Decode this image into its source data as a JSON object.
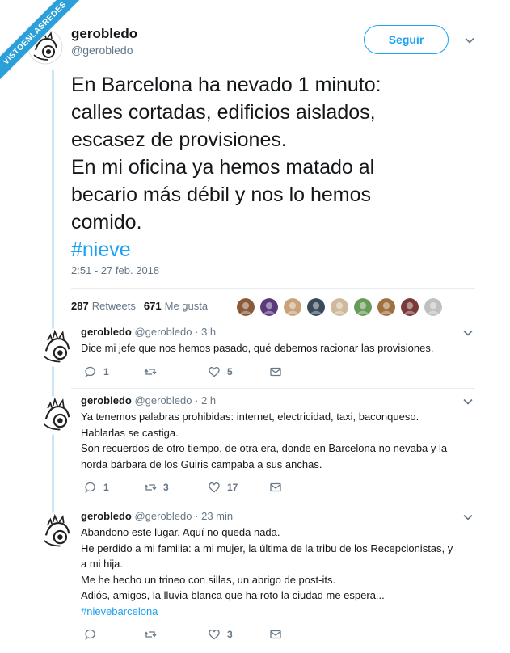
{
  "watermark": {
    "text": "VISTOENLASREDES"
  },
  "main_tweet": {
    "display_name": "gerobledo",
    "handle": "@gerobledo",
    "follow_label": "Seguir",
    "text_lines": [
      "En Barcelona ha nevado 1 minuto:",
      "calles cortadas, edificios aislados,",
      "escasez de provisiones.",
      "En mi oficina ya hemos matado al",
      "becario más débil y nos lo hemos",
      "comido."
    ],
    "hashtag": "#nieve",
    "timestamp": "2:51 - 27 feb. 2018",
    "retweets_count": "287",
    "retweets_label": "Retweets",
    "likes_count": "671",
    "likes_label": "Me gusta",
    "liker_avatar_colors": [
      "#8a5a3a",
      "#5a3a7a",
      "#c9a27a",
      "#3a4a5a",
      "#d0b89a",
      "#6a9a5a",
      "#a07040",
      "#7a3a3a",
      "#c0c0c0"
    ]
  },
  "replies": [
    {
      "display_name": "gerobledo",
      "handle": "@gerobledo",
      "time": "3 h",
      "text_lines": [
        "Dice mi jefe que nos hemos pasado, qué debemos racionar las provisiones."
      ],
      "reply_count": "1",
      "retweet_count": "",
      "like_count": "5"
    },
    {
      "display_name": "gerobledo",
      "handle": "@gerobledo",
      "time": "2 h",
      "text_lines": [
        "Ya tenemos palabras prohibidas: internet, electricidad, taxi, baconqueso.",
        "Hablarlas se castiga.",
        "Son recuerdos de otro tiempo, de otra era, donde en Barcelona no nevaba y la",
        "horda bárbara de los Guiris campaba a sus anchas."
      ],
      "reply_count": "1",
      "retweet_count": "3",
      "like_count": "17"
    },
    {
      "display_name": "gerobledo",
      "handle": "@gerobledo",
      "time": "23 min",
      "text_lines": [
        "Abandono este lugar. Aquí no queda nada.",
        "He perdido a mi familia: a mi mujer, la última de la tribu de los Recepcionistas, y",
        "a mi hija.",
        "Me he hecho un trineo con sillas, un abrigo de post-its.",
        "Adiós, amigos, la lluvia-blanca que ha roto la ciudad me espera..."
      ],
      "hashtag": "#nievebarcelona",
      "reply_count": "",
      "retweet_count": "",
      "like_count": "3"
    }
  ],
  "colors": {
    "accent": "#1da1f2",
    "muted": "#657786",
    "text": "#14171a",
    "thread_line": "#cce6f8",
    "ribbon": "#2b9fd8"
  },
  "icons": [
    "chevron-down-icon",
    "reply-icon",
    "retweet-icon",
    "like-icon",
    "message-icon"
  ]
}
